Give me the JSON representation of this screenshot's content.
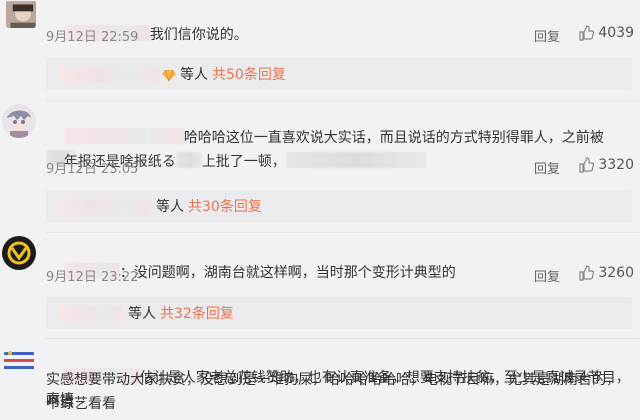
{
  "comments": [
    {
      "text": "我们信你说的。",
      "date": "9月12日 22:59",
      "reply_label": "回复",
      "likes": "4039",
      "subreply": {
        "prefix": "等人",
        "count_label": "共50条回复"
      }
    },
    {
      "text_part1": "哈哈哈这位一直喜欢说大实话，而且说话的方式特别得罪人，之前被",
      "text_part2": "年报还是啥报纸る",
      "text_part3": "上批了一顿，",
      "date": "9月12日 23:05",
      "reply_label": "回复",
      "likes": "3320",
      "subreply": {
        "prefix": "等人",
        "count_label": "共30条回复"
      }
    },
    {
      "text": "：没问题啊，湖南台就这样啊，当时那个变形计典型的",
      "date": "9月12日 23:22",
      "reply_label": "回复",
      "likes": "3260",
      "subreply": {
        "prefix": "等人",
        "count_label": "共32条回复"
      }
    },
    {
      "text_line1": "估计是人家老总花钱赞助，也有认真准备，想要支持扶贫，至少是真诚录节目，真情",
      "text_line2": "实感想要带动大家扶贫，没想到是一堆狗屎，哈哈哈哈哈哈，电视节目嘛，尤其是湖南台的，呵当",
      "text_line3": "个综艺看看"
    }
  ],
  "colors": {
    "accent": "#eb7350",
    "background": "#f2f2f5",
    "meta": "#8a8a8a"
  },
  "icons": [
    "thumbs-up-icon",
    "diamond-badge-icon"
  ]
}
